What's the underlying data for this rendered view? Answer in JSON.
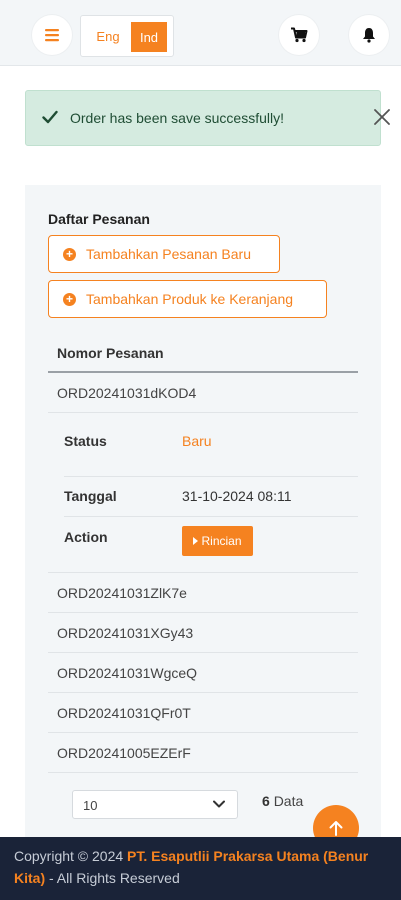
{
  "header": {
    "lang_eng": "Eng",
    "lang_ind": "Ind",
    "icons": {
      "menu": "hamburger-icon",
      "cart": "cart-icon",
      "notifications": "bell-icon"
    }
  },
  "alert": {
    "message": "Order has been save successfully!",
    "icon": "check-icon",
    "close_icon": "close-icon"
  },
  "orders": {
    "title": "Daftar Pesanan",
    "add_order_label": "Tambahkan Pesanan Baru",
    "add_product_label": "Tambahkan Produk ke Keranjang",
    "column_header": "Nomor Pesanan",
    "expanded": {
      "id": "ORD20241031dKOD4",
      "status_label": "Status",
      "status_value": "Baru",
      "date_label": "Tanggal",
      "date_value": "31-10-2024 08:11",
      "action_label": "Action",
      "action_button": "Rincian"
    },
    "rows": [
      "ORD20241031ZlK7e",
      "ORD20241031XGy43",
      "ORD20241031WgceQ",
      "ORD20241031QFr0T",
      "ORD20241005EZErF"
    ],
    "page_size": "10",
    "count_number": "6",
    "count_label": "Data"
  },
  "footer": {
    "prefix": "Copyright © 2024 ",
    "company": "PT. Esaputlii Prakarsa Utama (Benur Kita)",
    "suffix": " - All Rights Reserved"
  },
  "colors": {
    "accent": "#f58220",
    "alert_bg": "#d5ebe0",
    "footer_bg": "#1a2338"
  }
}
